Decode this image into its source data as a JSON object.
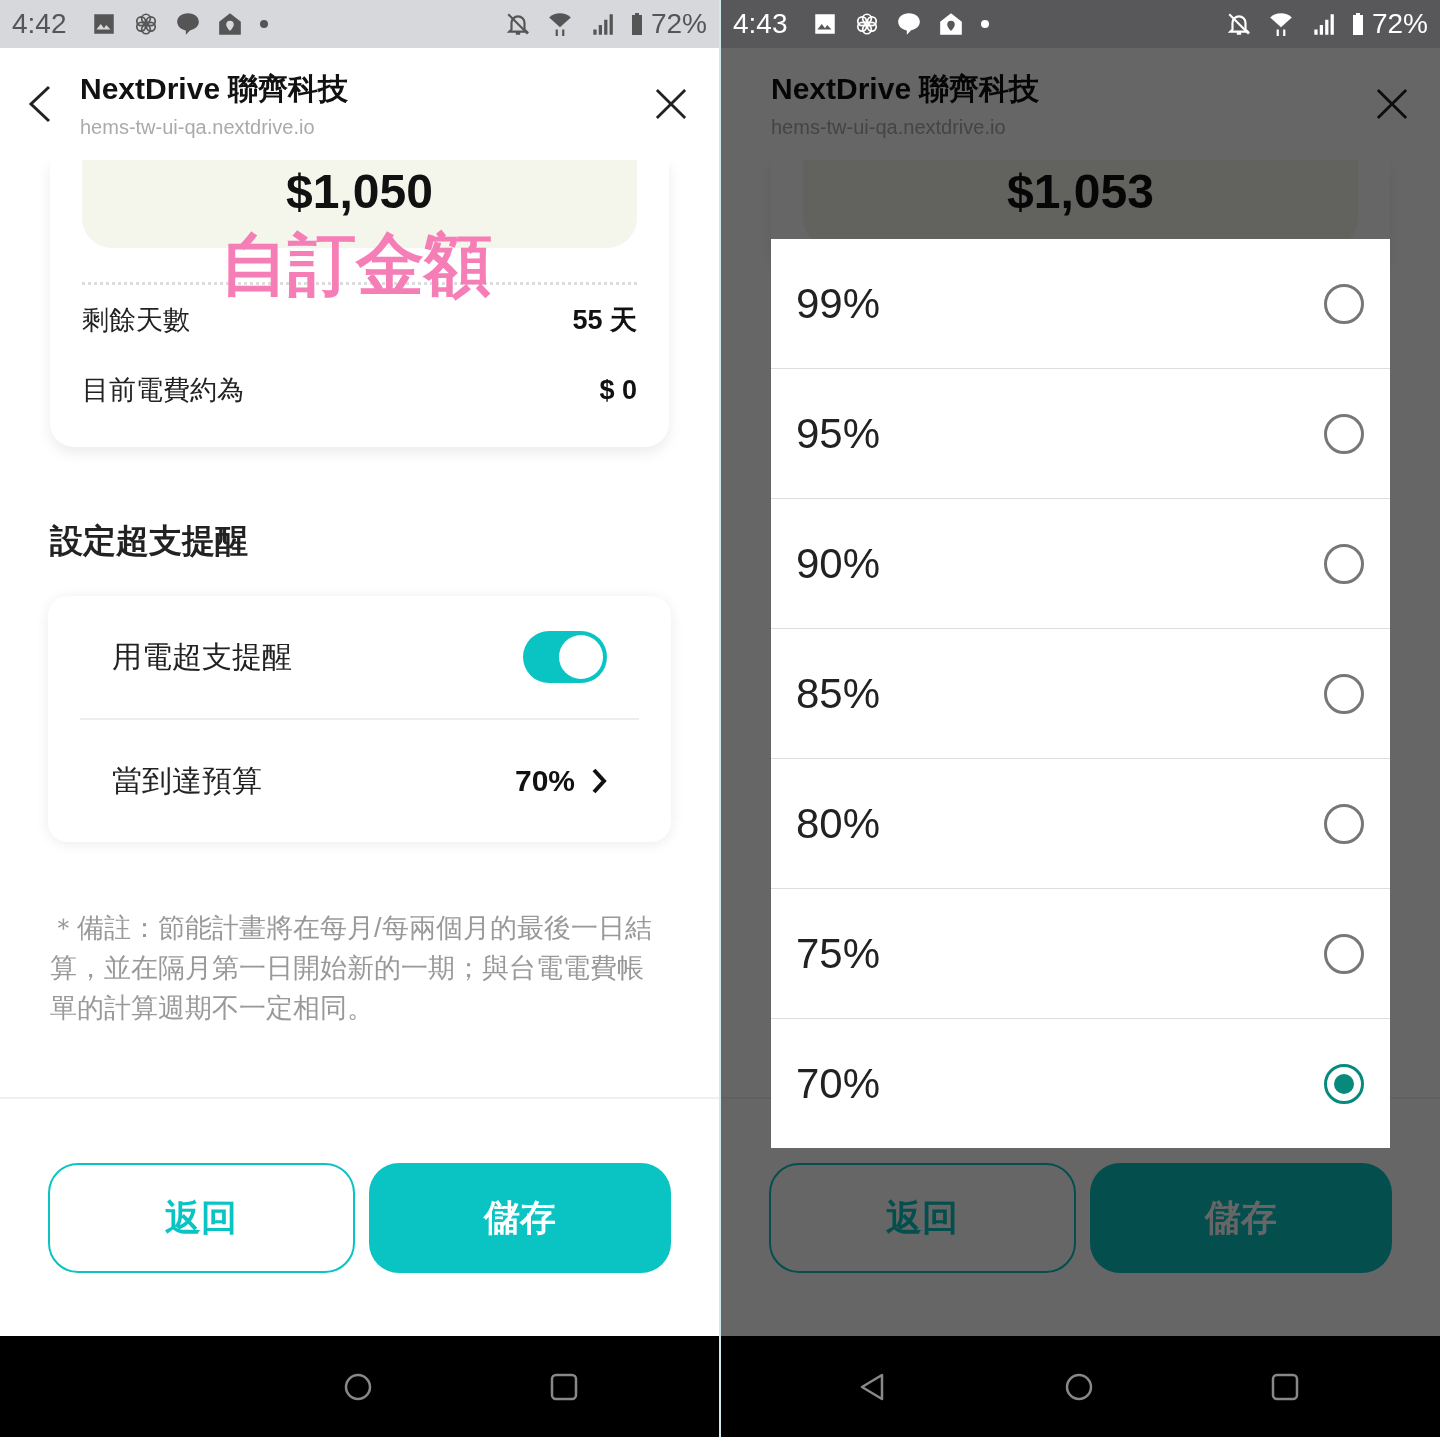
{
  "screens": [
    {
      "status_bar": {
        "dark": false,
        "time": "4:42",
        "battery": "72%"
      },
      "header": {
        "back": true,
        "title": "NextDrive 聯齊科技",
        "url": "hems-tw-ui-qa.nextdrive.io"
      },
      "budget_card": {
        "amount": "$1,050",
        "annotation": "自訂金額",
        "rows": [
          {
            "label": "剩餘天數",
            "value": "55 天"
          },
          {
            "label": "目前電費約為",
            "value": "$ 0"
          }
        ]
      },
      "section_title": "設定超支提醒",
      "alert_card": {
        "toggle": {
          "label": "用電超支提醒",
          "on": true
        },
        "threshold": {
          "label": "當到達預算",
          "value": "70%"
        }
      },
      "note": "＊備註：節能計畫將在每月/每兩個月的最後一日結算，並在隔月第一日開始新的一期；與台電電費帳單的計算週期不一定相同。",
      "buttons": [
        {
          "label": "返回",
          "kind": "outline"
        },
        {
          "label": "儲存",
          "kind": "filled"
        }
      ],
      "nav_bar": [
        {
          "kind": "home"
        },
        {
          "kind": "recents"
        }
      ]
    },
    {
      "status_bar": {
        "dark": true,
        "time": "4:43",
        "battery": "72%"
      },
      "dimmed": true,
      "header": {
        "back": false,
        "title": "NextDrive 聯齊科技",
        "url": "hems-tw-ui-qa.nextdrive.io"
      },
      "budget_card": {
        "amount": "$1,053"
      },
      "buttons": [
        {
          "label": "返回",
          "kind": "outline"
        },
        {
          "label": "儲存",
          "kind": "filled"
        }
      ],
      "dialog": {
        "options": [
          {
            "label": "99%",
            "selected": false
          },
          {
            "label": "95%",
            "selected": false
          },
          {
            "label": "90%",
            "selected": false
          },
          {
            "label": "85%",
            "selected": false
          },
          {
            "label": "80%",
            "selected": false
          },
          {
            "label": "75%",
            "selected": false
          },
          {
            "label": "70%",
            "selected": true
          }
        ]
      },
      "nav_bar": [
        {
          "kind": "back"
        },
        {
          "kind": "home"
        },
        {
          "kind": "recents"
        }
      ]
    }
  ]
}
